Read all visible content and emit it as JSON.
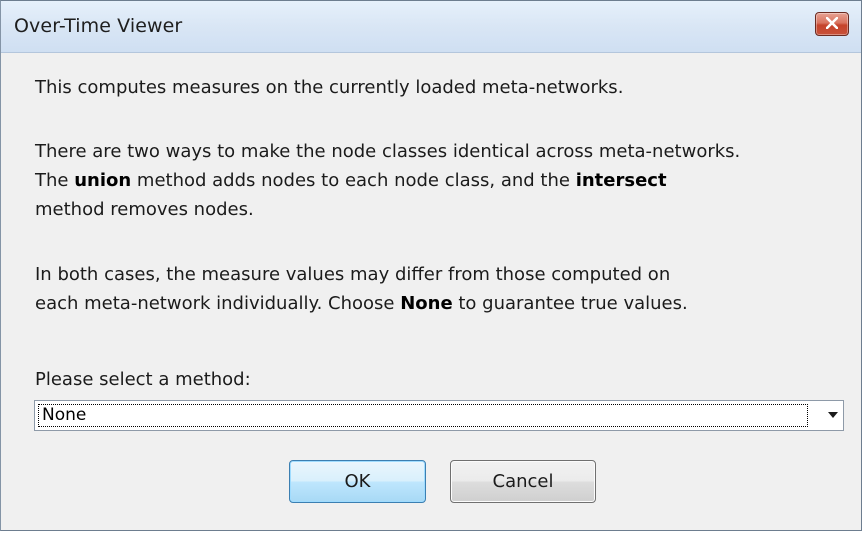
{
  "window": {
    "title": "Over-Time Viewer"
  },
  "body": {
    "intro": "This computes measures on the currently loaded meta-networks.",
    "methods_p1": "There are two ways to make the node classes identical across meta-networks.",
    "methods_p2_a": "The ",
    "methods_p2_union": "union",
    "methods_p2_b": " method adds nodes to each node class, and the ",
    "methods_p2_intersect": "intersect",
    "methods_p3": "method removes nodes.",
    "caveat_p1": "In both cases, the measure values may differ from those computed on",
    "caveat_p2_a": "each meta-network individually. Choose ",
    "caveat_p2_none": "None",
    "caveat_p2_b": " to guarantee true values."
  },
  "form": {
    "select_label": "Please select a method:",
    "method_selected": "None"
  },
  "buttons": {
    "ok_label": "OK",
    "cancel_label": "Cancel"
  },
  "icons": {
    "close": "close-icon",
    "dropdown": "chevron-down-icon"
  },
  "colors": {
    "close_button": "#c8513a",
    "ok_border": "#3c7fb1"
  }
}
